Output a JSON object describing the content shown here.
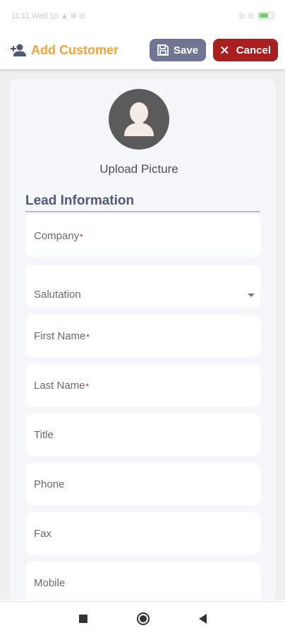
{
  "status_bar": {
    "left_text": "11:11 Wed 10 ▲ ⊕ ⊙",
    "right_text": "⊙ ⊙"
  },
  "header": {
    "title": "Add Customer",
    "title_color": "#f0a43a",
    "icon": "add-person-icon",
    "save_label": "Save",
    "save_icon": "floppy-disk-icon",
    "save_color": "#6f7592",
    "cancel_label": "Cancel",
    "cancel_icon": "close-icon",
    "cancel_color": "#a71f1f"
  },
  "profile": {
    "avatar_icon": "user-silhouette-icon",
    "upload_label": "Upload Picture"
  },
  "section": {
    "title": "Lead Information"
  },
  "fields": [
    {
      "label": "Company",
      "required": true,
      "type": "text"
    },
    {
      "label": "Salutation",
      "required": false,
      "type": "select"
    },
    {
      "label": "First Name",
      "required": true,
      "type": "text"
    },
    {
      "label": "Last Name",
      "required": true,
      "type": "text"
    },
    {
      "label": "Title",
      "required": false,
      "type": "text"
    },
    {
      "label": "Phone",
      "required": false,
      "type": "text"
    },
    {
      "label": "Fax",
      "required": false,
      "type": "text"
    },
    {
      "label": "Mobile",
      "required": false,
      "type": "text"
    }
  ],
  "required_marker": "*",
  "nav": {
    "recents_icon": "square-icon",
    "home_icon": "circle-icon",
    "back_icon": "back-triangle-icon"
  }
}
